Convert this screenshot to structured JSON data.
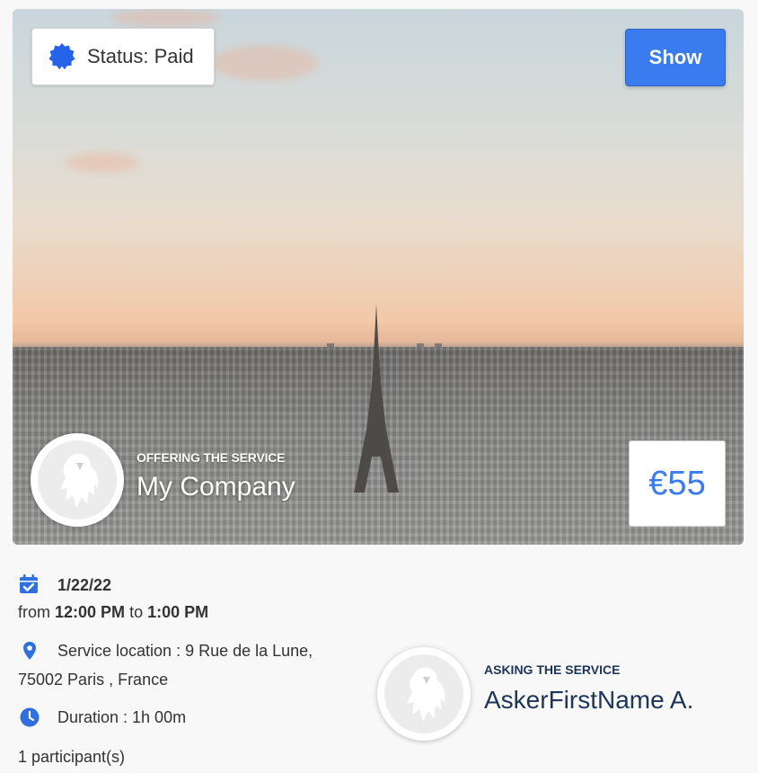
{
  "header": {
    "status_label": "Status: Paid",
    "show_label": "Show"
  },
  "provider": {
    "role_label": "OFFERING THE SERVICE",
    "name": "My Company"
  },
  "price": "€55",
  "event": {
    "date": "1/22/22",
    "time_from_prefix": "from",
    "time_start": "12:00 PM",
    "time_to_word": "to",
    "time_end": "1:00 PM",
    "location_line1": "Service location : 9 Rue de la Lune,",
    "location_line2": "75002 Paris , France",
    "duration": "Duration : 1h 00m",
    "participants": "1 participant(s)"
  },
  "asker": {
    "role_label": "ASKING THE SERVICE",
    "name": "AskerFirstName A."
  },
  "colors": {
    "accent": "#3a7bef",
    "dark_navy": "#1d3557"
  },
  "icons": {
    "status": "verified-badge-icon",
    "calendar": "calendar-check-icon",
    "location": "location-pin-icon",
    "clock": "clock-icon",
    "avatar": "eagle-placeholder-icon"
  }
}
